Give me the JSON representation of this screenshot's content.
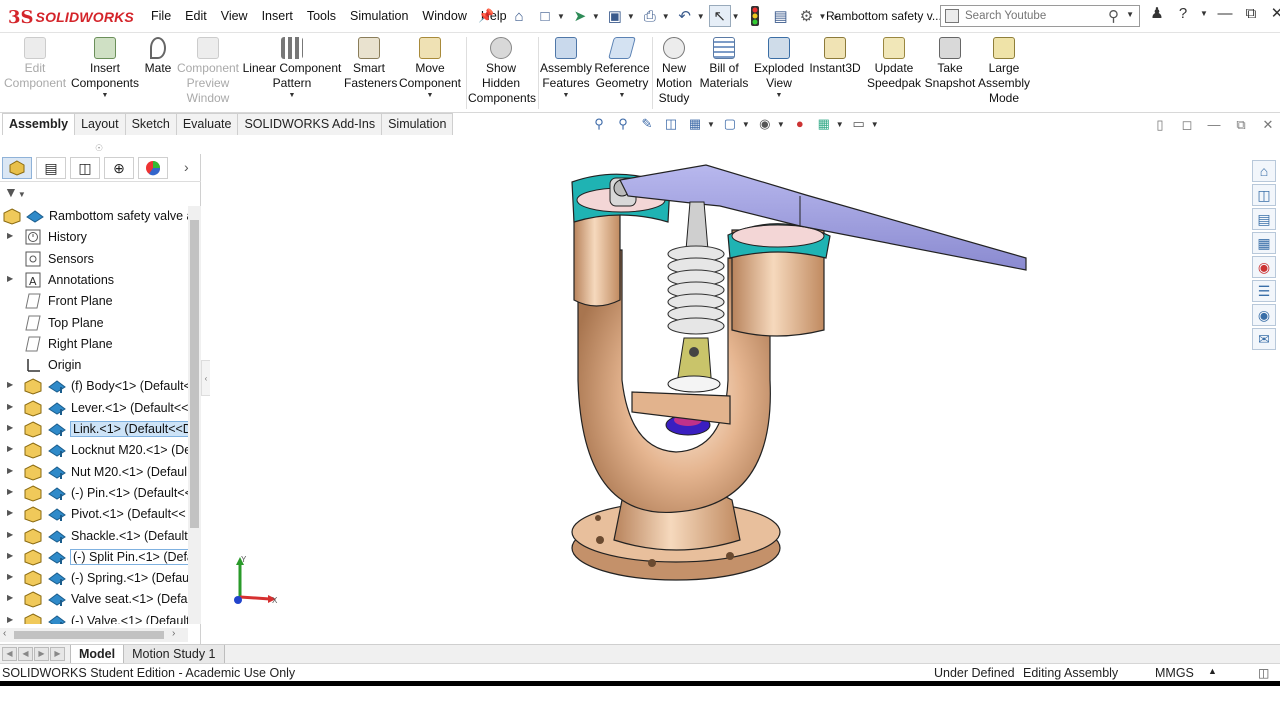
{
  "app": {
    "logo_ds": "3S",
    "logo_text": "SOLIDWORKS",
    "menus": [
      "File",
      "Edit",
      "View",
      "Insert",
      "Tools",
      "Simulation",
      "Window",
      "Help"
    ],
    "document_title": "Rambottom safety v...",
    "search_placeholder": "Search Youtube",
    "help_label": "?"
  },
  "ribbon": {
    "buttons": [
      {
        "label": "Edit\nComponent",
        "disabled": true,
        "icon": "edit-component-icon"
      },
      {
        "label": "Insert\nComponents",
        "disabled": false,
        "icon": "insert-components-icon"
      },
      {
        "label": "Mate",
        "disabled": false,
        "icon": "mate-icon"
      },
      {
        "label": "Component\nPreview\nWindow",
        "disabled": true,
        "icon": "component-preview-icon"
      },
      {
        "label": "Linear Component\nPattern",
        "disabled": false,
        "icon": "linear-pattern-icon"
      },
      {
        "label": "Smart\nFasteners",
        "disabled": false,
        "icon": "smart-fasteners-icon"
      },
      {
        "label": "Move\nComponent",
        "disabled": false,
        "icon": "move-component-icon"
      },
      {
        "label": "Show\nHidden\nComponents",
        "disabled": false,
        "icon": "show-hidden-icon"
      },
      {
        "label": "Assembly\nFeatures",
        "disabled": false,
        "icon": "assembly-features-icon"
      },
      {
        "label": "Reference\nGeometry",
        "disabled": false,
        "icon": "reference-geometry-icon"
      },
      {
        "label": "New\nMotion\nStudy",
        "disabled": false,
        "icon": "motion-study-icon"
      },
      {
        "label": "Bill of\nMaterials",
        "disabled": false,
        "icon": "bill-of-materials-icon"
      },
      {
        "label": "Exploded\nView",
        "disabled": false,
        "icon": "exploded-view-icon"
      },
      {
        "label": "Instant3D",
        "disabled": false,
        "icon": "instant3d-icon"
      },
      {
        "label": "Update\nSpeedpak",
        "disabled": false,
        "icon": "speedpak-icon"
      },
      {
        "label": "Take\nSnapshot",
        "disabled": false,
        "icon": "snapshot-icon"
      },
      {
        "label": "Large\nAssembly\nMode",
        "disabled": false,
        "icon": "large-assembly-icon"
      }
    ]
  },
  "tabs": [
    "Assembly",
    "Layout",
    "Sketch",
    "Evaluate",
    "SOLIDWORKS Add-Ins",
    "Simulation"
  ],
  "active_tab": "Assembly",
  "tree": {
    "root": "Rambottom safety valve a",
    "items": [
      {
        "label": "History",
        "icon": "history-icon",
        "expandable": true
      },
      {
        "label": "Sensors",
        "icon": "sensors-icon",
        "expandable": false
      },
      {
        "label": "Annotations",
        "icon": "annotations-icon",
        "expandable": true
      },
      {
        "label": "Front Plane",
        "icon": "plane-icon",
        "expandable": false
      },
      {
        "label": "Top Plane",
        "icon": "plane-icon",
        "expandable": false
      },
      {
        "label": "Right Plane",
        "icon": "plane-icon",
        "expandable": false
      },
      {
        "label": "Origin",
        "icon": "origin-icon",
        "expandable": false
      },
      {
        "label": "(f) Body<1> (Default<",
        "icon": "part-icon",
        "expandable": true
      },
      {
        "label": "Lever.<1> (Default<<",
        "icon": "part-icon",
        "expandable": true
      },
      {
        "label": "Link.<1> (Default<<D",
        "icon": "part-icon",
        "expandable": true,
        "selected": true
      },
      {
        "label": "Locknut M20.<1> (De",
        "icon": "part-icon",
        "expandable": true
      },
      {
        "label": "Nut M20.<1> (Defaul",
        "icon": "part-icon",
        "expandable": true
      },
      {
        "label": "(-) Pin.<1> (Default<<",
        "icon": "part-icon",
        "expandable": true
      },
      {
        "label": "Pivot.<1> (Default<<",
        "icon": "part-icon",
        "expandable": true
      },
      {
        "label": "Shackle.<1> (Default-",
        "icon": "part-icon",
        "expandable": true
      },
      {
        "label": "(-) Split Pin.<1> (Defa",
        "icon": "part-icon",
        "expandable": true,
        "outlined": true
      },
      {
        "label": "(-) Spring.<1> (Defau",
        "icon": "part-icon",
        "expandable": true
      },
      {
        "label": "Valve seat.<1> (Defau",
        "icon": "part-icon",
        "expandable": true
      },
      {
        "label": "(-) Valve.<1> (Default",
        "icon": "part-icon",
        "expandable": true
      }
    ]
  },
  "bottom_tabs": [
    "Model",
    "Motion Study 1"
  ],
  "active_bottom_tab": "Model",
  "status": {
    "edition": "SOLIDWORKS Student Edition - Academic Use Only",
    "definition": "Under Defined",
    "mode": "Editing Assembly",
    "units": "MMGS"
  },
  "triad": {
    "x": "X",
    "y": "Y"
  },
  "colors": {
    "body": "#e2b38d",
    "accent_teal": "#1fb3b3",
    "lever": "#9c9cdc",
    "brand_red": "#d4242a"
  }
}
